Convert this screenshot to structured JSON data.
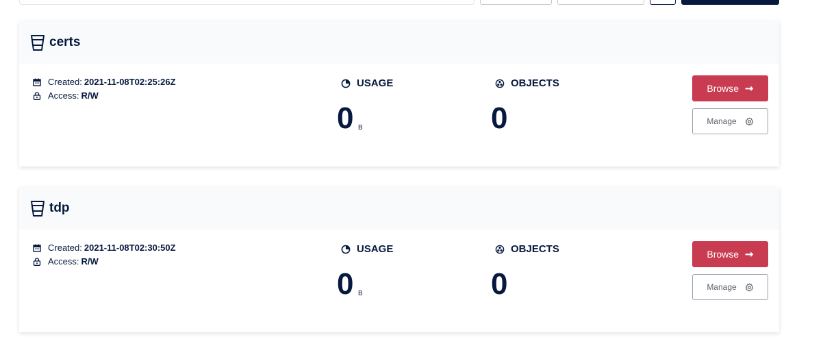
{
  "buckets": [
    {
      "name": "certs",
      "created_label": "Created:",
      "created_value": "2021-11-08T02:25:26Z",
      "access_label": "Access:",
      "access_value": "R/W",
      "usage_label": "USAGE",
      "usage_value": "0",
      "usage_unit": "B",
      "objects_label": "OBJECTS",
      "objects_value": "0",
      "browse_label": "Browse",
      "manage_label": "Manage"
    },
    {
      "name": "tdp",
      "created_label": "Created:",
      "created_value": "2021-11-08T02:30:50Z",
      "access_label": "Access:",
      "access_value": "R/W",
      "usage_label": "USAGE",
      "usage_value": "0",
      "usage_unit": "B",
      "objects_label": "OBJECTS",
      "objects_value": "0",
      "browse_label": "Browse",
      "manage_label": "Manage"
    }
  ],
  "icons": {
    "bucket": "bucket-icon",
    "calendar": "calendar-icon",
    "access": "lock-icon",
    "usage": "pie-chart-icon",
    "objects": "objects-icon",
    "browse_arrow": "arrow-right-icon",
    "manage": "gear-icon"
  },
  "colors": {
    "primary_text": "#07193e",
    "browse_button": "#c83b51",
    "header_bg": "#f8fafc"
  }
}
